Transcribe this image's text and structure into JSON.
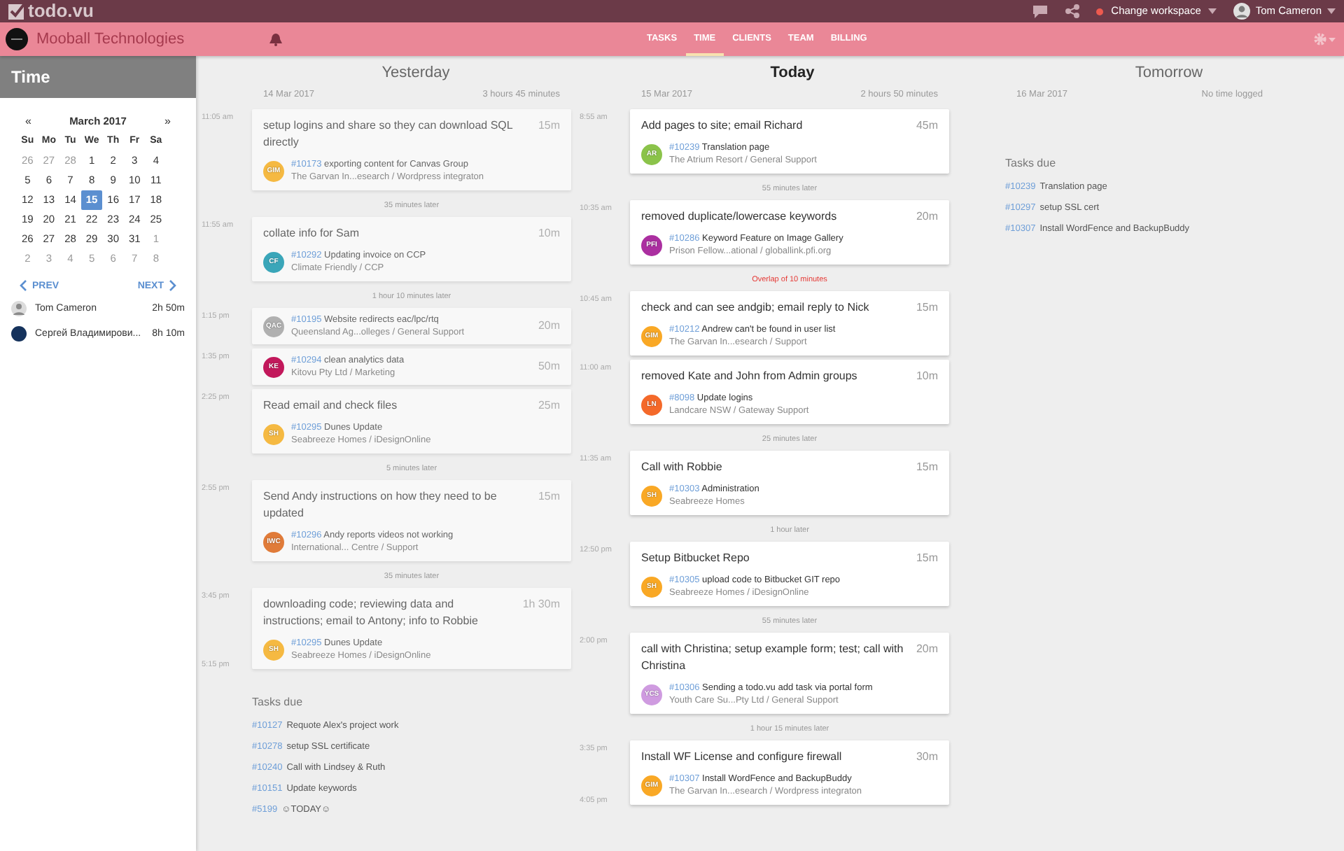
{
  "topbar": {
    "logo": "todo.vu",
    "workspace": "Change workspace",
    "user": "Tom Cameron"
  },
  "navbar": {
    "company": "Mooball Technologies",
    "tabs": [
      {
        "label": "TASKS",
        "selected": false
      },
      {
        "label": "TIME",
        "selected": true
      },
      {
        "label": "CLIENTS",
        "selected": false
      },
      {
        "label": "TEAM",
        "selected": false
      },
      {
        "label": "BILLING",
        "selected": false
      }
    ]
  },
  "sidebar": {
    "title": "Time",
    "calendar": {
      "prev": "«",
      "month": "March 2017",
      "next": "»",
      "weekdays": [
        "Su",
        "Mo",
        "Tu",
        "We",
        "Th",
        "Fr",
        "Sa"
      ],
      "weeks": [
        [
          {
            "label": "26",
            "other_month": true,
            "selected": false
          },
          {
            "label": "27",
            "other_month": true,
            "selected": false
          },
          {
            "label": "28",
            "other_month": true,
            "selected": false
          },
          {
            "label": "1",
            "other_month": false,
            "selected": false
          },
          {
            "label": "2",
            "other_month": false,
            "selected": false
          },
          {
            "label": "3",
            "other_month": false,
            "selected": false
          },
          {
            "label": "4",
            "other_month": false,
            "selected": false
          }
        ],
        [
          {
            "label": "5",
            "other_month": false,
            "selected": false
          },
          {
            "label": "6",
            "other_month": false,
            "selected": false
          },
          {
            "label": "7",
            "other_month": false,
            "selected": false
          },
          {
            "label": "8",
            "other_month": false,
            "selected": false
          },
          {
            "label": "9",
            "other_month": false,
            "selected": false
          },
          {
            "label": "10",
            "other_month": false,
            "selected": false
          },
          {
            "label": "11",
            "other_month": false,
            "selected": false
          }
        ],
        [
          {
            "label": "12",
            "other_month": false,
            "selected": false
          },
          {
            "label": "13",
            "other_month": false,
            "selected": false
          },
          {
            "label": "14",
            "other_month": false,
            "selected": false
          },
          {
            "label": "15",
            "other_month": false,
            "selected": true
          },
          {
            "label": "16",
            "other_month": false,
            "selected": false
          },
          {
            "label": "17",
            "other_month": false,
            "selected": false
          },
          {
            "label": "18",
            "other_month": false,
            "selected": false
          }
        ],
        [
          {
            "label": "19",
            "other_month": false,
            "selected": false
          },
          {
            "label": "20",
            "other_month": false,
            "selected": false
          },
          {
            "label": "21",
            "other_month": false,
            "selected": false
          },
          {
            "label": "22",
            "other_month": false,
            "selected": false
          },
          {
            "label": "23",
            "other_month": false,
            "selected": false
          },
          {
            "label": "24",
            "other_month": false,
            "selected": false
          },
          {
            "label": "25",
            "other_month": false,
            "selected": false
          }
        ],
        [
          {
            "label": "26",
            "other_month": false,
            "selected": false
          },
          {
            "label": "27",
            "other_month": false,
            "selected": false
          },
          {
            "label": "28",
            "other_month": false,
            "selected": false
          },
          {
            "label": "29",
            "other_month": false,
            "selected": false
          },
          {
            "label": "30",
            "other_month": false,
            "selected": false
          },
          {
            "label": "31",
            "other_month": false,
            "selected": false
          },
          {
            "label": "1",
            "other_month": true,
            "selected": false
          }
        ],
        [
          {
            "label": "2",
            "other_month": true,
            "selected": false
          },
          {
            "label": "3",
            "other_month": true,
            "selected": false
          },
          {
            "label": "4",
            "other_month": true,
            "selected": false
          },
          {
            "label": "5",
            "other_month": true,
            "selected": false
          },
          {
            "label": "6",
            "other_month": true,
            "selected": false
          },
          {
            "label": "7",
            "other_month": true,
            "selected": false
          },
          {
            "label": "8",
            "other_month": true,
            "selected": false
          }
        ]
      ]
    },
    "prev": "PREV",
    "next": "NEXT",
    "users": [
      {
        "name": "Tom Cameron",
        "hours": "2h 50m",
        "kind": "photo"
      },
      {
        "name": "Сергей Владимирови...",
        "hours": "8h 10m",
        "kind": "dark"
      }
    ]
  },
  "days": [
    {
      "kind": "past",
      "title": "Yesterday",
      "date": "14 Mar 2017",
      "total": "3 hours 45 minutes",
      "items": [
        {
          "kind": "entry",
          "time": "11:05 am",
          "title": "setup logins and share so they can download SQL directly",
          "duration": "15m",
          "task_id": "#10173",
          "task": "exporting content for Canvas Group",
          "initials": "GIM",
          "color": "#f5b942",
          "project": "The Garvan In...esearch / Wordpress integraton"
        },
        {
          "kind": "gap",
          "text": "35 minutes later"
        },
        {
          "kind": "entry",
          "time": "11:55 am",
          "title": "collate info for Sam",
          "duration": "10m",
          "task_id": "#10292",
          "task": "Updating invoice on CCP",
          "initials": "CF",
          "color": "#3aa6b9",
          "project": "Climate Friendly / CCP"
        },
        {
          "kind": "gap",
          "text": "1 hour 10 minutes later"
        },
        {
          "kind": "entry",
          "time": "1:15 pm",
          "duration": "20m",
          "task_id": "#10195",
          "task": "Website redirects eac/lpc/rtq",
          "initials": "QAC",
          "color": "#b0b0b0",
          "project": "Queensland Ag...olleges / General Support"
        },
        {
          "kind": "entry",
          "time": "1:35 pm",
          "duration": "50m",
          "task_id": "#10294",
          "task": "clean analytics data",
          "initials": "KE",
          "color": "#c2185b",
          "project": "Kitovu Pty Ltd / Marketing"
        },
        {
          "kind": "entry",
          "time": "2:25 pm",
          "title": "Read email and check files",
          "duration": "25m",
          "task_id": "#10295",
          "task": "Dunes Update",
          "initials": "SH",
          "color": "#f5b942",
          "project": "Seabreeze Homes / iDesignOnline"
        },
        {
          "kind": "gap",
          "text": "5 minutes later"
        },
        {
          "kind": "entry",
          "time": "2:55 pm",
          "title": "Send Andy instructions on how they need to be updated",
          "duration": "15m",
          "task_id": "#10296",
          "task": "Andy reports videos not working",
          "initials": "IWC",
          "color": "#e07b39",
          "project": "International... Centre / Support"
        },
        {
          "kind": "gap",
          "text": "35 minutes later"
        },
        {
          "kind": "entry",
          "time": "3:45 pm",
          "title": "downloading code; reviewing data and instructions; email to Antony; info to Robbie",
          "duration": "1h 30m",
          "task_id": "#10295",
          "task": "Dunes Update",
          "initials": "SH",
          "color": "#f5b942",
          "project": "Seabreeze Homes / iDesignOnline",
          "end_time": "5:15 pm"
        }
      ],
      "tasks_due_title": "Tasks due",
      "tasks_due": [
        {
          "id": "#10127",
          "name": "Requote Alex's project work"
        },
        {
          "id": "#10278",
          "name": "setup SSL certificate"
        },
        {
          "id": "#10240",
          "name": "Call with Lindsey & Ruth"
        },
        {
          "id": "#10151",
          "name": "Update keywords"
        },
        {
          "id": "#5199",
          "name": "☺TODAY☺"
        }
      ]
    },
    {
      "kind": "today",
      "title": "Today",
      "date": "15 Mar 2017",
      "total": "2 hours 50 minutes",
      "items": [
        {
          "kind": "entry",
          "time": "8:55 am",
          "title": "Add pages to site; email Richard",
          "duration": "45m",
          "task_id": "#10239",
          "task": "Translation page",
          "initials": "AR",
          "color": "#8bc34a",
          "project": "The Atrium Resort / General Support"
        },
        {
          "kind": "gap",
          "text": "55 minutes later"
        },
        {
          "kind": "entry",
          "time": "10:35 am",
          "title": "removed duplicate/lowercase keywords",
          "duration": "20m",
          "task_id": "#10286",
          "task": "Keyword Feature on Image Gallery",
          "initials": "PFI",
          "color": "#ab2fa0",
          "project": "Prison Fellow...ational / globallink.pfi.org"
        },
        {
          "kind": "overlap",
          "text": "Overlap of 10 minutes"
        },
        {
          "kind": "entry",
          "time": "10:45 am",
          "title": "check and can see andgib; email reply to Nick",
          "duration": "15m",
          "task_id": "#10212",
          "task": "Andrew can't be found in user list",
          "initials": "GIM",
          "color": "#f9a825",
          "project": "The Garvan In...esearch / Support"
        },
        {
          "kind": "entry",
          "time": "11:00 am",
          "title": "removed Kate and John from Admin groups",
          "duration": "10m",
          "task_id": "#8098",
          "task": "Update logins",
          "initials": "LN",
          "color": "#f4692a",
          "project": "Landcare NSW / Gateway Support"
        },
        {
          "kind": "gap",
          "text": "25 minutes later"
        },
        {
          "kind": "entry",
          "time": "11:35 am",
          "title": "Call with Robbie",
          "duration": "15m",
          "task_id": "#10303",
          "task": "Administration",
          "initials": "SH",
          "color": "#f9a825",
          "project": "Seabreeze Homes"
        },
        {
          "kind": "gap",
          "text": "1 hour later"
        },
        {
          "kind": "entry",
          "time": "12:50 pm",
          "title": "Setup Bitbucket Repo",
          "duration": "15m",
          "task_id": "#10305",
          "task": "upload code to Bitbucket GIT repo",
          "initials": "SH",
          "color": "#f9a825",
          "project": "Seabreeze Homes / iDesignOnline"
        },
        {
          "kind": "gap",
          "text": "55 minutes later"
        },
        {
          "kind": "entry",
          "time": "2:00 pm",
          "title": "call with Christina; setup example form; test; call with Christina",
          "duration": "20m",
          "task_id": "#10306",
          "task": "Sending a todo.vu add task via portal form",
          "initials": "YCS",
          "color": "#cf9be0",
          "project": "Youth Care Su...Pty Ltd / General Support"
        },
        {
          "kind": "gap",
          "text": "1 hour 15 minutes later"
        },
        {
          "kind": "entry",
          "time": "3:35 pm",
          "title": "Install WF License and configure firewall",
          "duration": "30m",
          "task_id": "#10307",
          "task": "Install WordFence and BackupBuddy",
          "initials": "GIM",
          "color": "#f9a825",
          "project": "The Garvan In...esearch / Wordpress integraton",
          "end_time": "4:05 pm"
        }
      ]
    },
    {
      "kind": "future",
      "title": "Tomorrow",
      "date": "16 Mar 2017",
      "total": "No time logged",
      "tasks_due_title": "Tasks due",
      "tasks_due": [
        {
          "id": "#10239",
          "name": "Translation page"
        },
        {
          "id": "#10297",
          "name": "setup SSL cert"
        },
        {
          "id": "#10307",
          "name": "Install WordFence and BackupBuddy"
        }
      ]
    }
  ]
}
